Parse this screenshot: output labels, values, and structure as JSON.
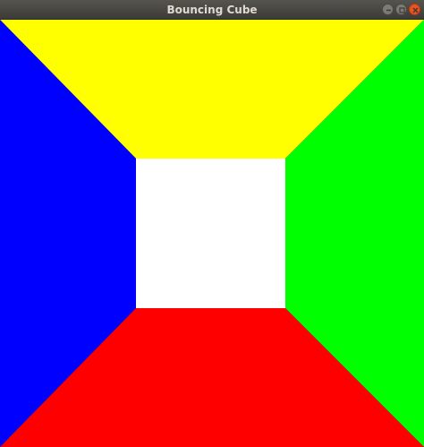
{
  "window": {
    "title": "Bouncing Cube"
  },
  "scene": {
    "colors": {
      "top_face": "#ffff00",
      "left_face": "#0000ff",
      "right_face": "#00ff00",
      "bottom_face": "#ff0000",
      "front_face": "#ffffff"
    }
  },
  "controls": {
    "minimize_icon": "minimize-icon",
    "maximize_icon": "maximize-icon",
    "close_icon": "close-icon"
  }
}
